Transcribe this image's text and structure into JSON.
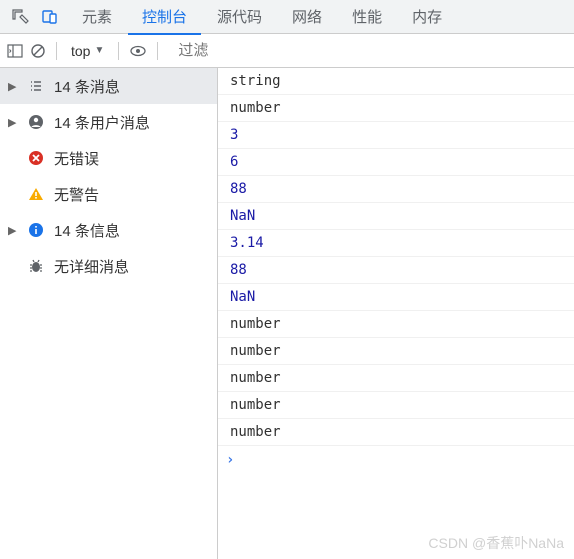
{
  "tabs": {
    "elements": "元素",
    "console": "控制台",
    "sources": "源代码",
    "network": "网络",
    "performance": "性能",
    "memory": "内存"
  },
  "toolbar": {
    "context": "top",
    "filter_placeholder": "过滤"
  },
  "sidebar": {
    "messages": "14 条消息",
    "user_messages": "14 条用户消息",
    "no_errors": "无错误",
    "no_warnings": "无警告",
    "info": "14 条信息",
    "no_verbose": "无详细消息"
  },
  "console": {
    "entries": [
      {
        "value": "string",
        "type": "str"
      },
      {
        "value": "number",
        "type": "str"
      },
      {
        "value": "3",
        "type": "num"
      },
      {
        "value": "6",
        "type": "num"
      },
      {
        "value": "88",
        "type": "num"
      },
      {
        "value": "NaN",
        "type": "num"
      },
      {
        "value": "3.14",
        "type": "num"
      },
      {
        "value": "88",
        "type": "num"
      },
      {
        "value": "NaN",
        "type": "num"
      },
      {
        "value": "number",
        "type": "str"
      },
      {
        "value": "number",
        "type": "str"
      },
      {
        "value": "number",
        "type": "str"
      },
      {
        "value": "number",
        "type": "str"
      },
      {
        "value": "number",
        "type": "str"
      }
    ],
    "prompt": "›"
  },
  "watermark": "CSDN @香蕉卟NaNa"
}
